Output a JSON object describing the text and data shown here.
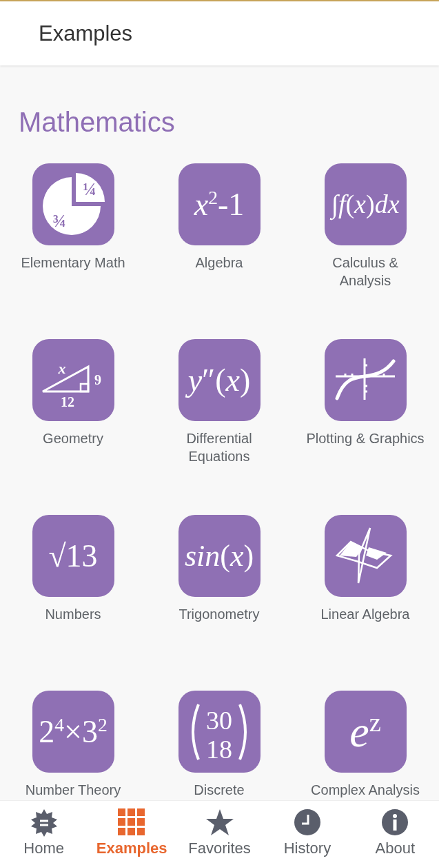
{
  "header": {
    "title": "Examples"
  },
  "section": {
    "title": "Mathematics"
  },
  "categories": [
    {
      "label": "Elementary Math",
      "kind": "pie",
      "marks": [
        "¼",
        "¾"
      ]
    },
    {
      "label": "Algebra",
      "kind": "formula",
      "formula": "*x*$^{2}$-1"
    },
    {
      "label": "Calculus &\nAnalysis",
      "kind": "formula",
      "formula": "∫*f*(*x*)*dx*"
    },
    {
      "label": "Geometry",
      "kind": "triangle",
      "marks": [
        "x",
        "9",
        "12"
      ]
    },
    {
      "label": "Differential\nEquations",
      "kind": "formula",
      "formula": "*y*″(*x*)"
    },
    {
      "label": "Plotting & Graphics",
      "kind": "plot"
    },
    {
      "label": "Numbers",
      "kind": "formula",
      "formula": "√13"
    },
    {
      "label": "Trigonometry",
      "kind": "formula",
      "formula": "*sin*(*x*)"
    },
    {
      "label": "Linear Algebra",
      "kind": "planes"
    },
    {
      "label": "Number Theory",
      "kind": "formula",
      "formula": "2$^{4}$×3$^{2}$"
    },
    {
      "label": "Discrete",
      "kind": "binomial",
      "marks": [
        "30",
        "18"
      ]
    },
    {
      "label": "Complex Analysis",
      "kind": "formula",
      "formula": "*e*$^{z}$"
    }
  ],
  "nav": [
    {
      "label": "Home",
      "selected": false
    },
    {
      "label": "Examples",
      "selected": true
    },
    {
      "label": "Favorites",
      "selected": false
    },
    {
      "label": "History",
      "selected": false
    },
    {
      "label": "About",
      "selected": false
    }
  ]
}
